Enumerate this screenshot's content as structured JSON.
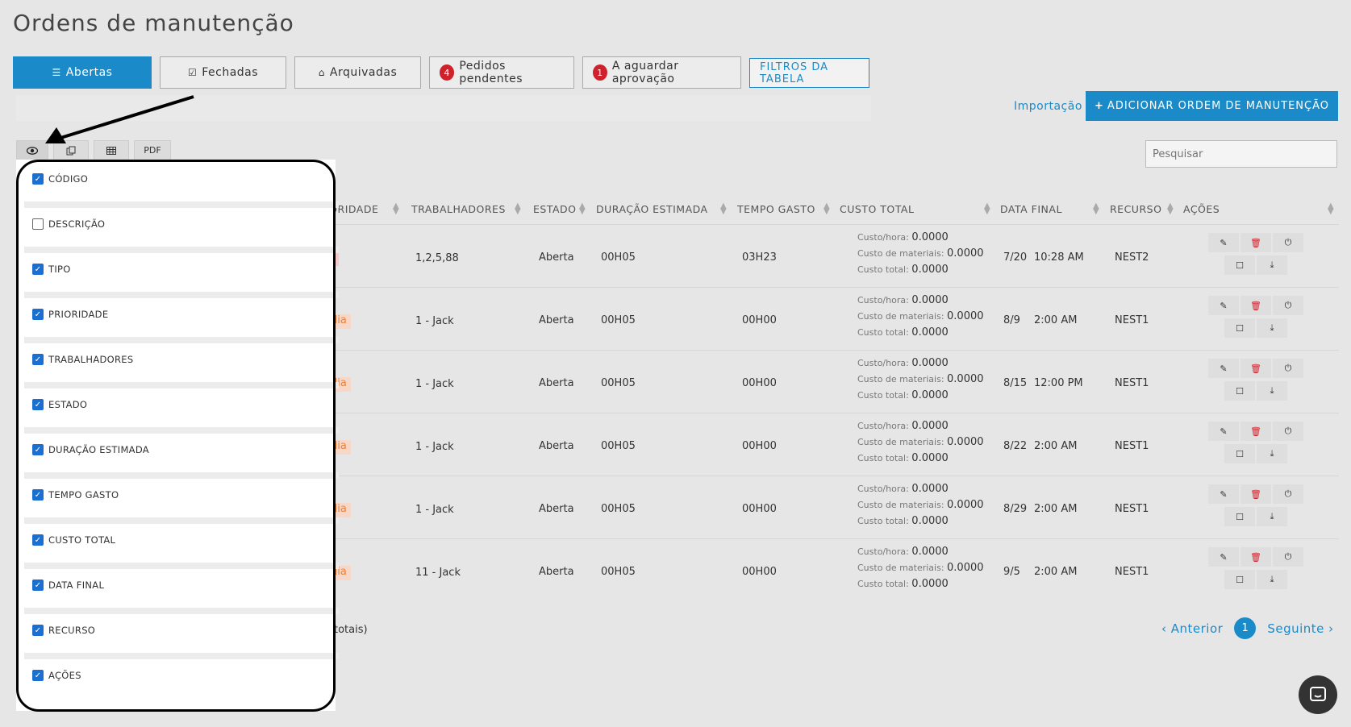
{
  "page": {
    "title": "Ordens de manutenção"
  },
  "tabs": [
    {
      "label": "Abertas",
      "icon": "list-icon",
      "active": true
    },
    {
      "label": "Fechadas",
      "icon": "check-square-icon"
    },
    {
      "label": "Arquivadas",
      "icon": "inbox-icon"
    },
    {
      "label": "Pedidos pendentes",
      "badge": "4"
    },
    {
      "label": "A aguardar aprovação",
      "badge": "1"
    },
    {
      "label": "FILTROS DA TABELA"
    }
  ],
  "header_actions": {
    "import_label": "Importação",
    "add_label": "ADICIONAR ORDEM DE MANUTENÇÃO",
    "add_icon": "+"
  },
  "table_tools": {
    "pdf_label": "PDF"
  },
  "search": {
    "placeholder": "Pesquisar"
  },
  "columns": [
    "IORIDADE",
    "TRABALHADORES",
    "ESTADO",
    "DURAÇÃO ESTIMADA",
    "TEMPO GASTO",
    "CUSTO TOTAL",
    "DATA FINAL",
    "RECURSO",
    "AÇÕES"
  ],
  "cost_labels": {
    "hour": "Custo/hora:",
    "materials": "Custo de materiais:",
    "total": "Custo total:"
  },
  "rows": [
    {
      "priority": "ta",
      "priority_kind": "alta",
      "workers": "1,2,5,88",
      "state": "Aberta",
      "est": "00H05",
      "spent": "03H23",
      "cost_hour": "0.0000",
      "cost_mat": "0.0000",
      "cost_total": "0.0000",
      "date": "7/20",
      "time": "10:28 AM",
      "resource": "NEST2"
    },
    {
      "priority": "édia",
      "priority_kind": "media",
      "workers": "1 - Jack",
      "state": "Aberta",
      "est": "00H05",
      "spent": "00H00",
      "cost_hour": "0.0000",
      "cost_mat": "0.0000",
      "cost_total": "0.0000",
      "date": "8/9",
      "time": "2:00 AM",
      "resource": "NEST1"
    },
    {
      "priority": "édia",
      "priority_kind": "media",
      "workers": "1 - Jack",
      "state": "Aberta",
      "est": "00H05",
      "spent": "00H00",
      "cost_hour": "0.0000",
      "cost_mat": "0.0000",
      "cost_total": "0.0000",
      "date": "8/15",
      "time": "12:00 PM",
      "resource": "NEST1"
    },
    {
      "priority": "édia",
      "priority_kind": "media",
      "workers": "1 - Jack",
      "state": "Aberta",
      "est": "00H05",
      "spent": "00H00",
      "cost_hour": "0.0000",
      "cost_mat": "0.0000",
      "cost_total": "0.0000",
      "date": "8/22",
      "time": "2:00 AM",
      "resource": "NEST1"
    },
    {
      "priority": "édia",
      "priority_kind": "media",
      "workers": "1 - Jack",
      "state": "Aberta",
      "est": "00H05",
      "spent": "00H00",
      "cost_hour": "0.0000",
      "cost_mat": "0.0000",
      "cost_total": "0.0000",
      "date": "8/29",
      "time": "2:00 AM",
      "resource": "NEST1"
    },
    {
      "priority": "édia",
      "priority_kind": "media",
      "workers": "11 - Jack",
      "state": "Aberta",
      "est": "00H05",
      "spent": "00H00",
      "cost_hour": "0.0000",
      "cost_mat": "0.0000",
      "cost_total": "0.0000",
      "date": "9/5",
      "time": "2:00 AM",
      "resource": "NEST1"
    }
  ],
  "footer": {
    "totals_text": "totais)"
  },
  "pager": {
    "prev": "‹ Anterior",
    "current": "1",
    "next": "Seguinte ›"
  },
  "column_visibility": [
    {
      "label": "CÓDIGO",
      "checked": true
    },
    {
      "label": "DESCRIÇÃO",
      "checked": false
    },
    {
      "label": "TIPO",
      "checked": true
    },
    {
      "label": "PRIORIDADE",
      "checked": true
    },
    {
      "label": "TRABALHADORES",
      "checked": true
    },
    {
      "label": "ESTADO",
      "checked": true
    },
    {
      "label": "DURAÇÃO ESTIMADA",
      "checked": true
    },
    {
      "label": "TEMPO GASTO",
      "checked": true
    },
    {
      "label": "CUSTO TOTAL",
      "checked": true
    },
    {
      "label": "DATA FINAL",
      "checked": true
    },
    {
      "label": "RECURSO",
      "checked": true
    },
    {
      "label": "AÇÕES",
      "checked": true
    }
  ],
  "colors": {
    "accent": "#1a8bc8",
    "danger": "#d0202b",
    "priority_media": "#e8823d",
    "priority_alta": "#e25a63"
  }
}
